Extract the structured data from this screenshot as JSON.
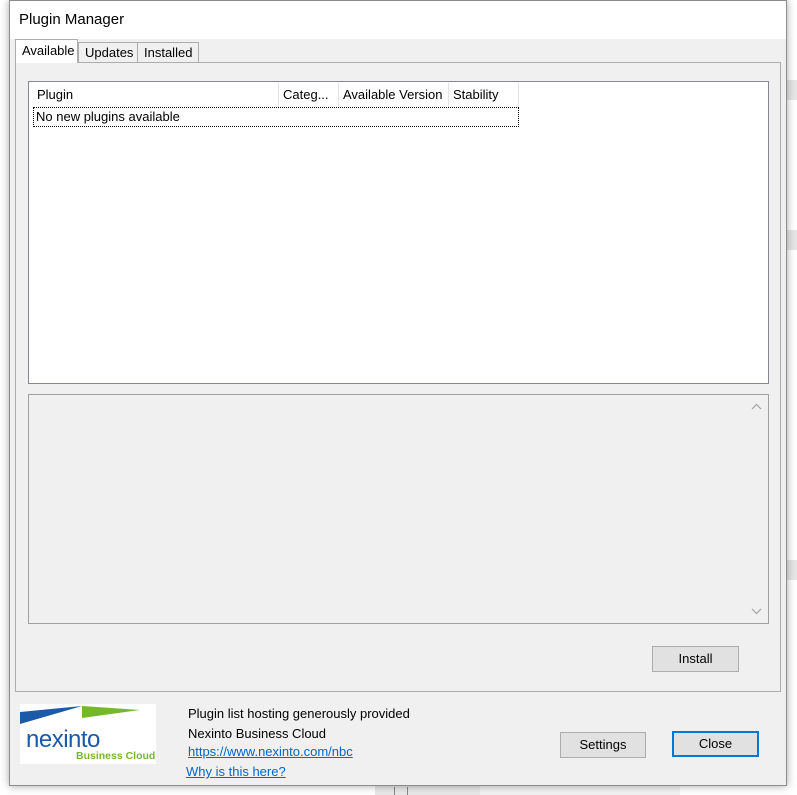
{
  "window": {
    "title": "Plugin Manager"
  },
  "tabs": [
    {
      "label": "Available",
      "active": true
    },
    {
      "label": "Updates",
      "active": false
    },
    {
      "label": "Installed",
      "active": false
    }
  ],
  "plugin_list": {
    "columns": [
      "Plugin",
      "Categ...",
      "Available Version",
      "Stability"
    ],
    "empty_message": "No new plugins available"
  },
  "buttons": {
    "install": "Install",
    "settings": "Settings",
    "close": "Close"
  },
  "footer": {
    "logo_text": "nexinto",
    "logo_subtext": "Business Cloud",
    "credit_line1": "Plugin list hosting generously provided",
    "credit_line2": "Nexinto Business Cloud",
    "credit_url": "https://www.nexinto.com/nbc",
    "why_link": "Why is this here?"
  },
  "colors": {
    "accent": "#0078d7",
    "logo_blue": "#1a5aa8",
    "logo_green": "#77b82a",
    "link": "#0066cc"
  }
}
